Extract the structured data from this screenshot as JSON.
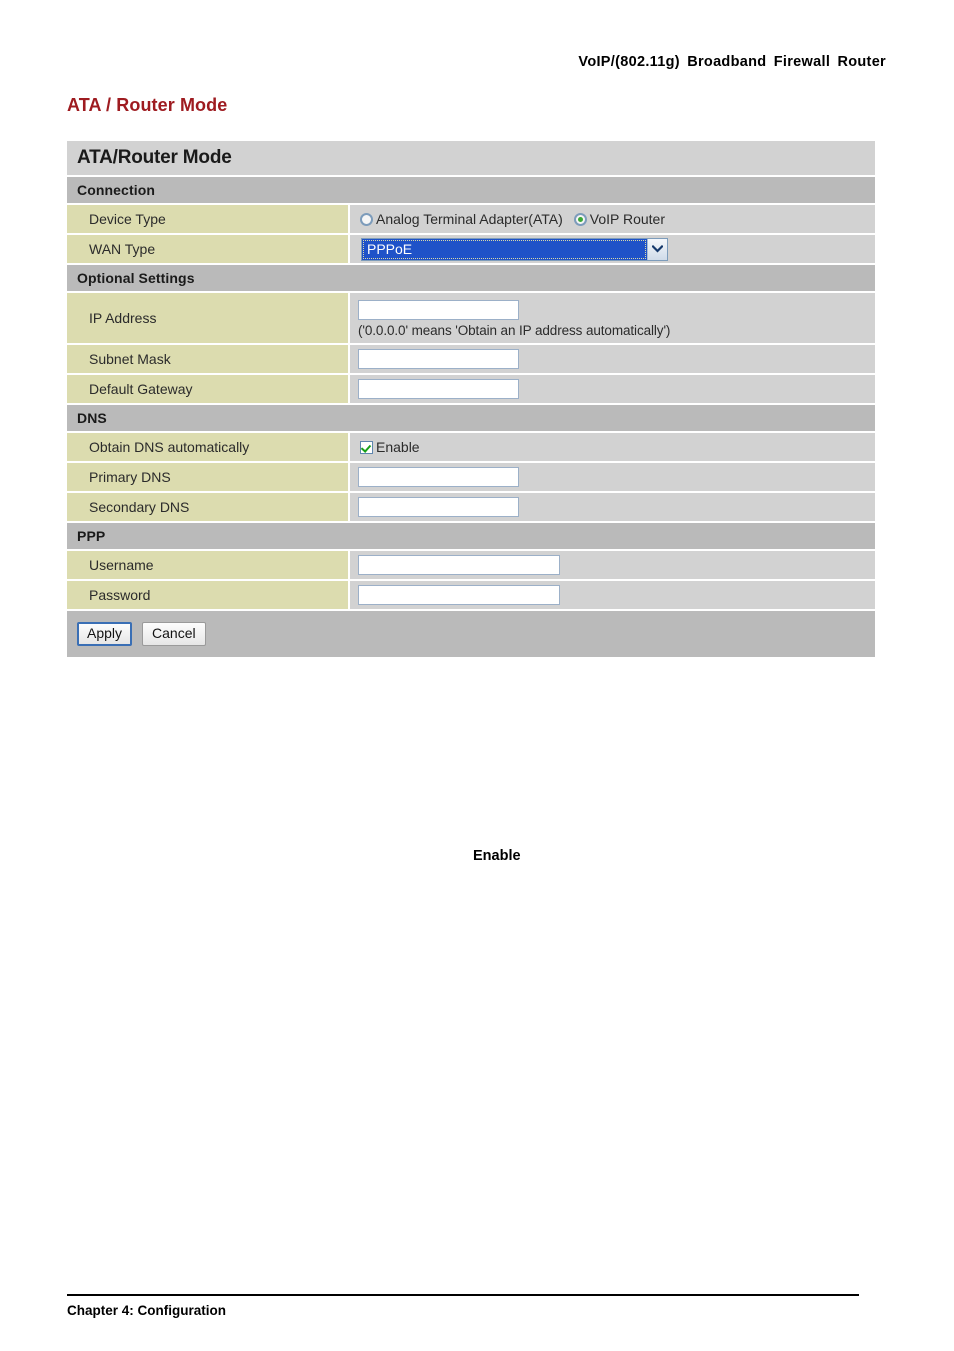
{
  "document": {
    "header_right": "VoIP/(802.11g)  Broadband  Firewall  Router",
    "page_heading": "ATA / Router Mode",
    "body_text": "Enable",
    "footer": "Chapter 4: Configuration"
  },
  "panel": {
    "title": "ATA/Router Mode",
    "sections": [
      {
        "heading": "Connection",
        "rows": [
          {
            "label": "Device Type",
            "control": "radio-group",
            "options": [
              {
                "label": "Analog Terminal Adapter(ATA)",
                "selected": false
              },
              {
                "label": "VoIP Router",
                "selected": true
              }
            ]
          },
          {
            "label": "WAN Type",
            "control": "select",
            "value": "PPPoE"
          }
        ]
      },
      {
        "heading": "Optional Settings",
        "rows": [
          {
            "label": "IP Address",
            "control": "text",
            "value": "",
            "hint": "('0.0.0.0' means 'Obtain an IP address automatically')"
          },
          {
            "label": "Subnet Mask",
            "control": "text",
            "value": ""
          },
          {
            "label": "Default Gateway",
            "control": "text",
            "value": ""
          }
        ]
      },
      {
        "heading": "DNS",
        "rows": [
          {
            "label": "Obtain DNS automatically",
            "control": "checkbox",
            "checkbox_label": "Enable",
            "checked": true
          },
          {
            "label": "Primary DNS",
            "control": "text",
            "value": ""
          },
          {
            "label": "Secondary DNS",
            "control": "text",
            "value": ""
          }
        ]
      },
      {
        "heading": "PPP",
        "rows": [
          {
            "label": "Username",
            "control": "text-wide",
            "value": ""
          },
          {
            "label": "Password",
            "control": "text-wide",
            "value": ""
          }
        ]
      }
    ],
    "buttons": {
      "apply": "Apply",
      "cancel": "Cancel"
    }
  },
  "colors": {
    "heading_red": "#9e1b20",
    "label_khaki": "#dcdcaf",
    "row_gray": "#d2d2d2",
    "section_gray": "#bababa",
    "select_highlight": "#1f52c8",
    "radio_dot_green": "#3aa836",
    "check_green": "#18a118",
    "focus_blue": "#3a6fb5"
  }
}
